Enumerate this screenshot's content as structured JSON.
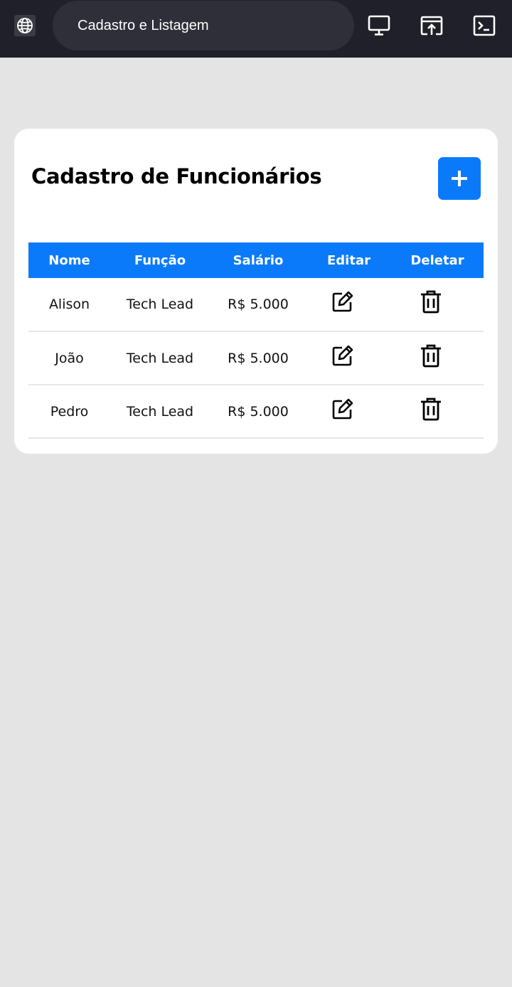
{
  "browser": {
    "url_title": "Cadastro e Listagem",
    "icons": [
      "globe-icon",
      "desktop-icon",
      "open-in-browser-icon",
      "terminal-icon"
    ]
  },
  "page": {
    "title": "Cadastro de Funcionários",
    "add_button_icon": "plus-icon",
    "accent_color": "#0a7afb"
  },
  "table": {
    "headers": [
      "Nome",
      "Função",
      "Salário",
      "Editar",
      "Deletar"
    ],
    "rows": [
      {
        "nome": "Alison",
        "funcao": "Tech Lead",
        "salario": "R$ 5.000"
      },
      {
        "nome": "João",
        "funcao": "Tech Lead",
        "salario": "R$ 5.000"
      },
      {
        "nome": "Pedro",
        "funcao": "Tech Lead",
        "salario": "R$ 5.000"
      }
    ]
  }
}
